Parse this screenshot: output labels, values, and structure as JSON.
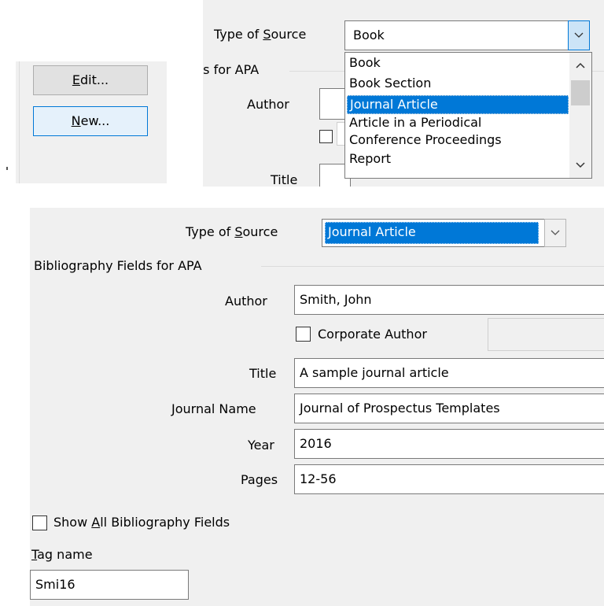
{
  "top_left": {
    "edit_button": {
      "pre": "",
      "accel": "E",
      "post": "dit..."
    },
    "new_button": {
      "pre": "",
      "accel": "N",
      "post": "ew..."
    }
  },
  "top_dropdown": {
    "type_label": {
      "pre": "Type of ",
      "accel": "S",
      "post": "ource"
    },
    "selected_value": "Book",
    "group_label_partial": "ds for APA",
    "author_label": "Author",
    "title_label": "Title",
    "options": [
      "Book",
      "Book Section",
      "Journal Article",
      "Article in a Periodical",
      "Conference Proceedings",
      "Report"
    ],
    "highlighted_option": "Journal Article"
  },
  "form": {
    "type_label": {
      "pre": "Type of ",
      "accel": "S",
      "post": "ource"
    },
    "selected_value": "Journal Article",
    "group_label": "Bibliography Fields for APA",
    "fields": {
      "author": {
        "label": "Author",
        "value": "Smith, John"
      },
      "corporate_author": {
        "label": "Corporate Author",
        "checked": false
      },
      "title": {
        "label": "Title",
        "value": "A sample journal article"
      },
      "journal_name": {
        "label": "Journal Name",
        "value": "Journal of Prospectus Templates"
      },
      "year": {
        "label": "Year",
        "value": "2016"
      },
      "pages": {
        "label": "Pages",
        "value": "12-56"
      }
    },
    "show_all": {
      "pre": "Show ",
      "accel": "A",
      "post": "ll Bibliography Fields",
      "checked": false
    },
    "tag_name": {
      "accel": "T",
      "post": "ag name",
      "value": "Smi16"
    }
  }
}
